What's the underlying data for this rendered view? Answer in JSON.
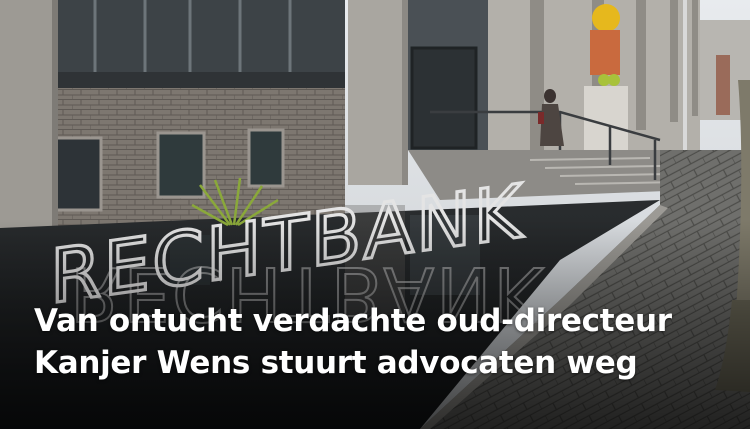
{
  "article": {
    "headline_line1": "Van ontucht verdachte oud-directeur",
    "headline_line2": "Kanjer Wens stuurt advocaten weg"
  },
  "image": {
    "sign_text": "RECHTBANK"
  },
  "colors": {
    "headline": "#ffffff",
    "water": "#1a1d1f",
    "brick": "#7d7770",
    "concrete": "#a9a6a0",
    "pavement": "#6f6f6c"
  }
}
